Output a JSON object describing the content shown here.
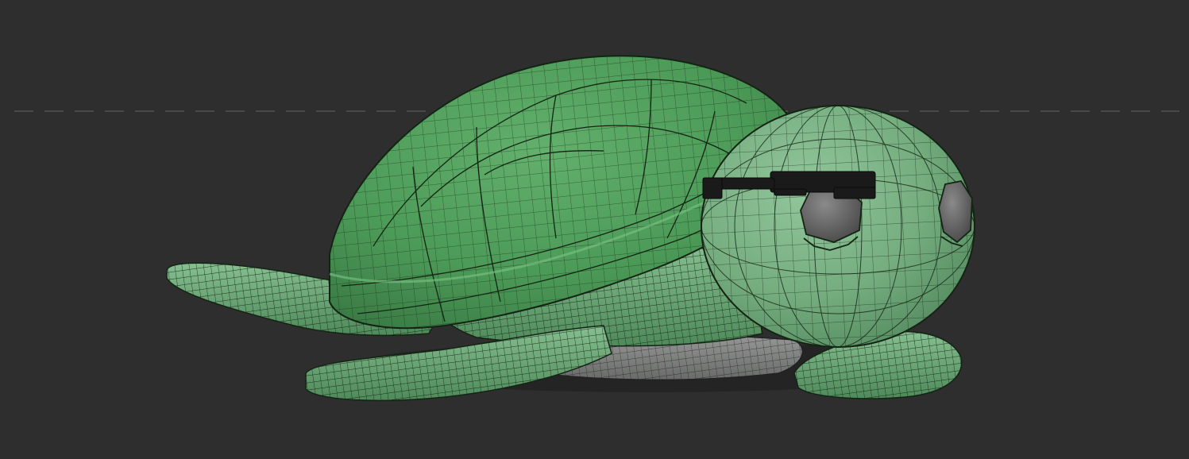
{
  "viewport": {
    "background_color": "#2e2e2e",
    "horizon_line_color": "#5a5a5a",
    "grid_style": "dashed"
  },
  "model": {
    "wireframe_overlay": true,
    "wire_color": "#142414",
    "shell_color": "#4f9e5a",
    "shell_shadow_color": "#3a7a45",
    "skin_color": "#6fae7a",
    "skin_shadow_color": "#4f8a5a",
    "head_color": "#78b282",
    "eye_color": "#6a6a6a",
    "glasses_color": "#1a1a1a",
    "shadow_color": "#1e1e1e"
  }
}
